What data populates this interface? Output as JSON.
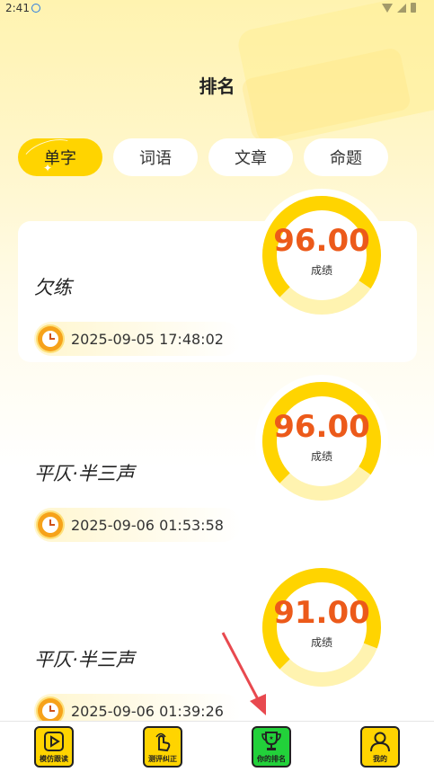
{
  "status_bar": {
    "time": "2:41"
  },
  "page": {
    "title": "排名"
  },
  "tabs": [
    {
      "label": "单字",
      "active": true
    },
    {
      "label": "词语",
      "active": false
    },
    {
      "label": "文章",
      "active": false
    },
    {
      "label": "命题",
      "active": false
    }
  ],
  "records": [
    {
      "name": "欠练",
      "time": "2025-09-05 17:48:02",
      "score": "96.00",
      "score_label": "成绩",
      "progress": 0.96
    },
    {
      "name": "平仄·半三声",
      "time": "2025-09-06 01:53:58",
      "score": "96.00",
      "score_label": "成绩",
      "progress": 0.96
    },
    {
      "name": "平仄·半三声",
      "time": "2025-09-06 01:39:26",
      "score": "91.00",
      "score_label": "成绩",
      "progress": 0.91
    }
  ],
  "bottom_nav": [
    {
      "label": "模仿跟读",
      "icon": "play-icon",
      "active": false
    },
    {
      "label": "测评纠正",
      "icon": "hand-tap-icon",
      "active": false
    },
    {
      "label": "你的排名",
      "icon": "trophy-icon",
      "active": true
    },
    {
      "label": "我的",
      "icon": "user-icon",
      "active": false
    }
  ],
  "colors": {
    "accent": "#ffd400",
    "score": "#ec5a1a",
    "nav_active": "#22d13a",
    "arrow": "#e8494f"
  }
}
